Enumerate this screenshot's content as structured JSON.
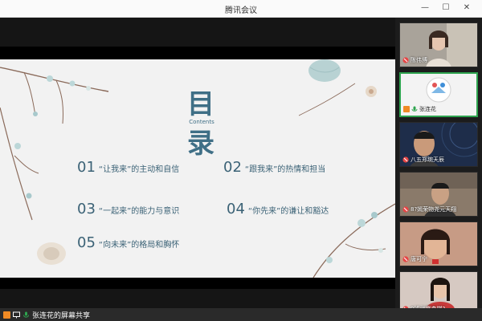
{
  "window": {
    "title": "腾讯会议"
  },
  "title_controls": {
    "minimize": "—",
    "maximize": "☐",
    "close": "✕"
  },
  "slide": {
    "title": "目录",
    "subtitle": "Contents",
    "items": [
      {
        "num": "01",
        "text": "“让我来”的主动和自信"
      },
      {
        "num": "02",
        "text": "“跟我来”的热情和担当"
      },
      {
        "num": "03",
        "text": "“一起来”的能力与意识"
      },
      {
        "num": "04",
        "text": "“你先来”的谦让和豁达"
      },
      {
        "num": "05",
        "text": "“向未来”的格局和胸怀"
      }
    ]
  },
  "participants": [
    {
      "name": "陈伟博",
      "type": "video",
      "bg": "#a9a39a"
    },
    {
      "name": "张连花",
      "type": "avatar",
      "bg": "#f3f3f3"
    },
    {
      "name": "八五郑琬天辰",
      "type": "video",
      "bg": "#1e2d4a"
    },
    {
      "name": "8?嫣荣物尧元天翔",
      "type": "video",
      "bg": "#8a7a6a"
    },
    {
      "name": "唐可宁",
      "type": "video",
      "bg": "#c79b85"
    },
    {
      "name": "9班武霖森棋?",
      "type": "video",
      "bg": "#d6c9c2"
    }
  ],
  "bottom": {
    "share_status": "张连花的屏幕共享"
  },
  "colors": {
    "accent": "#3f6f86",
    "active_border": "#2ea44f"
  }
}
